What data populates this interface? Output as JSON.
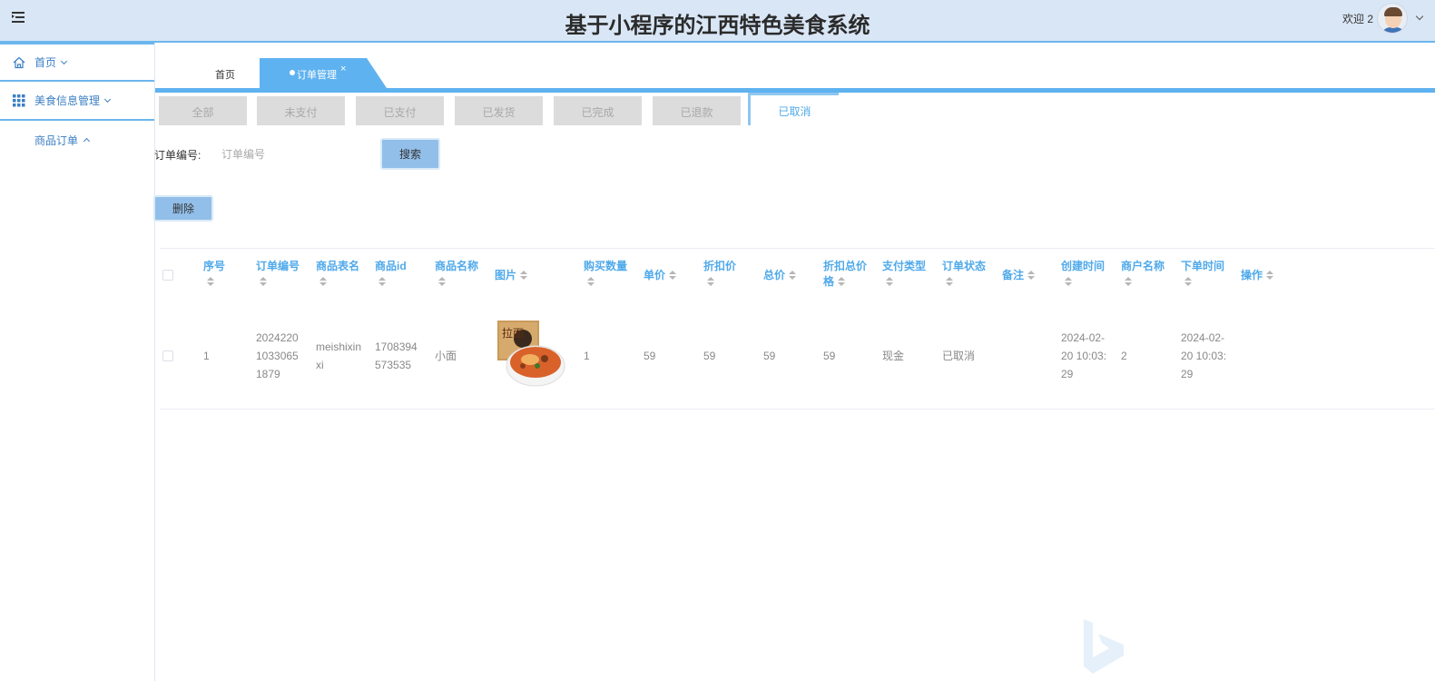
{
  "header": {
    "title": "基于小程序的江西特色美食系统",
    "welcome": "欢迎 2"
  },
  "sidebar": {
    "items": [
      {
        "label": "首页",
        "icon": "home-icon"
      },
      {
        "label": "美食信息管理",
        "icon": "grid-icon"
      }
    ],
    "sub_items": [
      {
        "label": "商品订单"
      }
    ]
  },
  "tabs": {
    "home": "首页",
    "active": "订单管理",
    "close": "×"
  },
  "status_tabs": [
    "全部",
    "未支付",
    "已支付",
    "已发货",
    "已完成",
    "已退款",
    "已取消"
  ],
  "status_active_index": 6,
  "search": {
    "label": "订单编号:",
    "placeholder": "订单编号",
    "button": "搜索"
  },
  "actions": {
    "delete": "删除"
  },
  "table": {
    "columns": [
      "序号",
      "订单编号",
      "商品表名",
      "商品id",
      "商品名称",
      "图片",
      "购买数量",
      "单价",
      "折扣价",
      "总价",
      "折扣总价格",
      "支付类型",
      "订单状态",
      "备注",
      "创建时间",
      "商户名称",
      "下单时间",
      "操作"
    ],
    "rows": [
      {
        "index": "1",
        "order_no": "20242201033065 1879",
        "order_no_lines": [
          "2024220",
          "1033065",
          "1879"
        ],
        "table_name_lines": [
          "meishixin",
          "xi"
        ],
        "goods_id_lines": [
          "1708394",
          "573535"
        ],
        "goods_name": "小面",
        "quantity": "1",
        "price": "59",
        "discount_price": "59",
        "total": "59",
        "discount_total": "59",
        "pay_type": "现金",
        "status": "已取消",
        "remark": "",
        "created_lines": [
          "2024-02-",
          "20 10:03:",
          "29"
        ],
        "merchant": "2",
        "ordered_lines": [
          "2024-02-",
          "20 10:03:",
          "29"
        ],
        "image_label": "拉面"
      }
    ]
  },
  "colors": {
    "header_bg": "#d9e6f6",
    "accent": "#5fb2f0",
    "link": "#4fa9ea",
    "button": "#92bfea"
  }
}
